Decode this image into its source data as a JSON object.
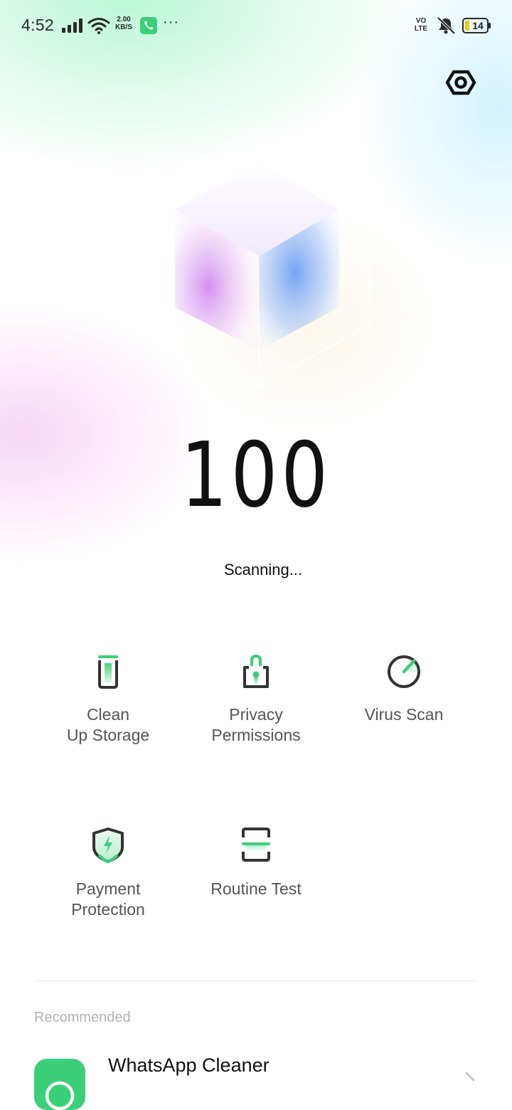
{
  "status_bar": {
    "time": "4:52",
    "network_speed_value": "2.00",
    "network_speed_unit": "KB/S",
    "more_indicator": "···",
    "volte_line1": "VO",
    "volte_line2": "LTE",
    "battery_level": "14"
  },
  "header": {
    "settings_icon": "settings-hexagon-icon"
  },
  "score": {
    "value": "100",
    "status_text": "Scanning..."
  },
  "tools": [
    {
      "label": "Clean Up Storage",
      "icon": "trash-icon"
    },
    {
      "label": "Privacy Permissions",
      "icon": "lock-icon"
    },
    {
      "label": "Virus Scan",
      "icon": "scan-gauge-icon"
    },
    {
      "label": "Payment Protection",
      "icon": "shield-icon"
    },
    {
      "label": "Routine Test",
      "icon": "routine-test-icon"
    }
  ],
  "recommended": {
    "section_label": "Recommended",
    "items": [
      {
        "title": "WhatsApp Cleaner",
        "icon": "whatsapp-icon"
      }
    ]
  },
  "colors": {
    "accent": "#3CCF7A",
    "icon_dark": "#333333"
  }
}
